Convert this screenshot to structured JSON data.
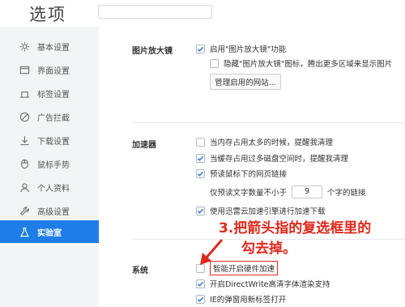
{
  "header": {
    "title": "选项"
  },
  "sidebar": {
    "items": [
      {
        "label": "基本设置",
        "icon": "gear-icon"
      },
      {
        "label": "界面设置",
        "icon": "window-icon"
      },
      {
        "label": "标签设置",
        "icon": "tab-icon"
      },
      {
        "label": "广告拦截",
        "icon": "block-icon"
      },
      {
        "label": "下载设置",
        "icon": "download-icon"
      },
      {
        "label": "鼠标手势",
        "icon": "mouse-icon"
      },
      {
        "label": "个人资料",
        "icon": "user-icon"
      },
      {
        "label": "高级设置",
        "icon": "wrench-icon"
      },
      {
        "label": "实验室",
        "icon": "flask-icon",
        "active": true
      }
    ]
  },
  "sections": {
    "magnifier": {
      "label": "图片放大镜",
      "enable": "启用\"图片放大镜\"功能",
      "hide_icon": "隐藏\"图片放大镜\"图标，腾出更多区域来显示图片",
      "manage_button": "管理启用的网站..."
    },
    "accelerator": {
      "label": "加速器",
      "mem_warn": "当内存占用太多的时候，提醒我清理",
      "disk_warn": "当缓存占用过多磁盘空间时，提醒我清理",
      "prefetch": "预读鼠标下的网页链接",
      "min_chars_prefix": "仅预读文字数量不小于",
      "min_chars_value": "9",
      "min_chars_suffix": "个字的链接",
      "xunlei": "使用迅雷云加速引擎进行加速下载"
    },
    "system": {
      "label": "系统",
      "hw_accel": "智能开启硬件加速",
      "directwrite": "开启DirectWrite高清字体渲染支持",
      "ie_popup": "IE的弹窗用新标签打开"
    }
  },
  "annotation": {
    "line1": "3.把箭头指的复选框里的",
    "line2": "勾去掉。"
  },
  "colors": {
    "accent": "#1e7de8",
    "annotation": "#e0281c",
    "check": "#2a6fd6"
  }
}
